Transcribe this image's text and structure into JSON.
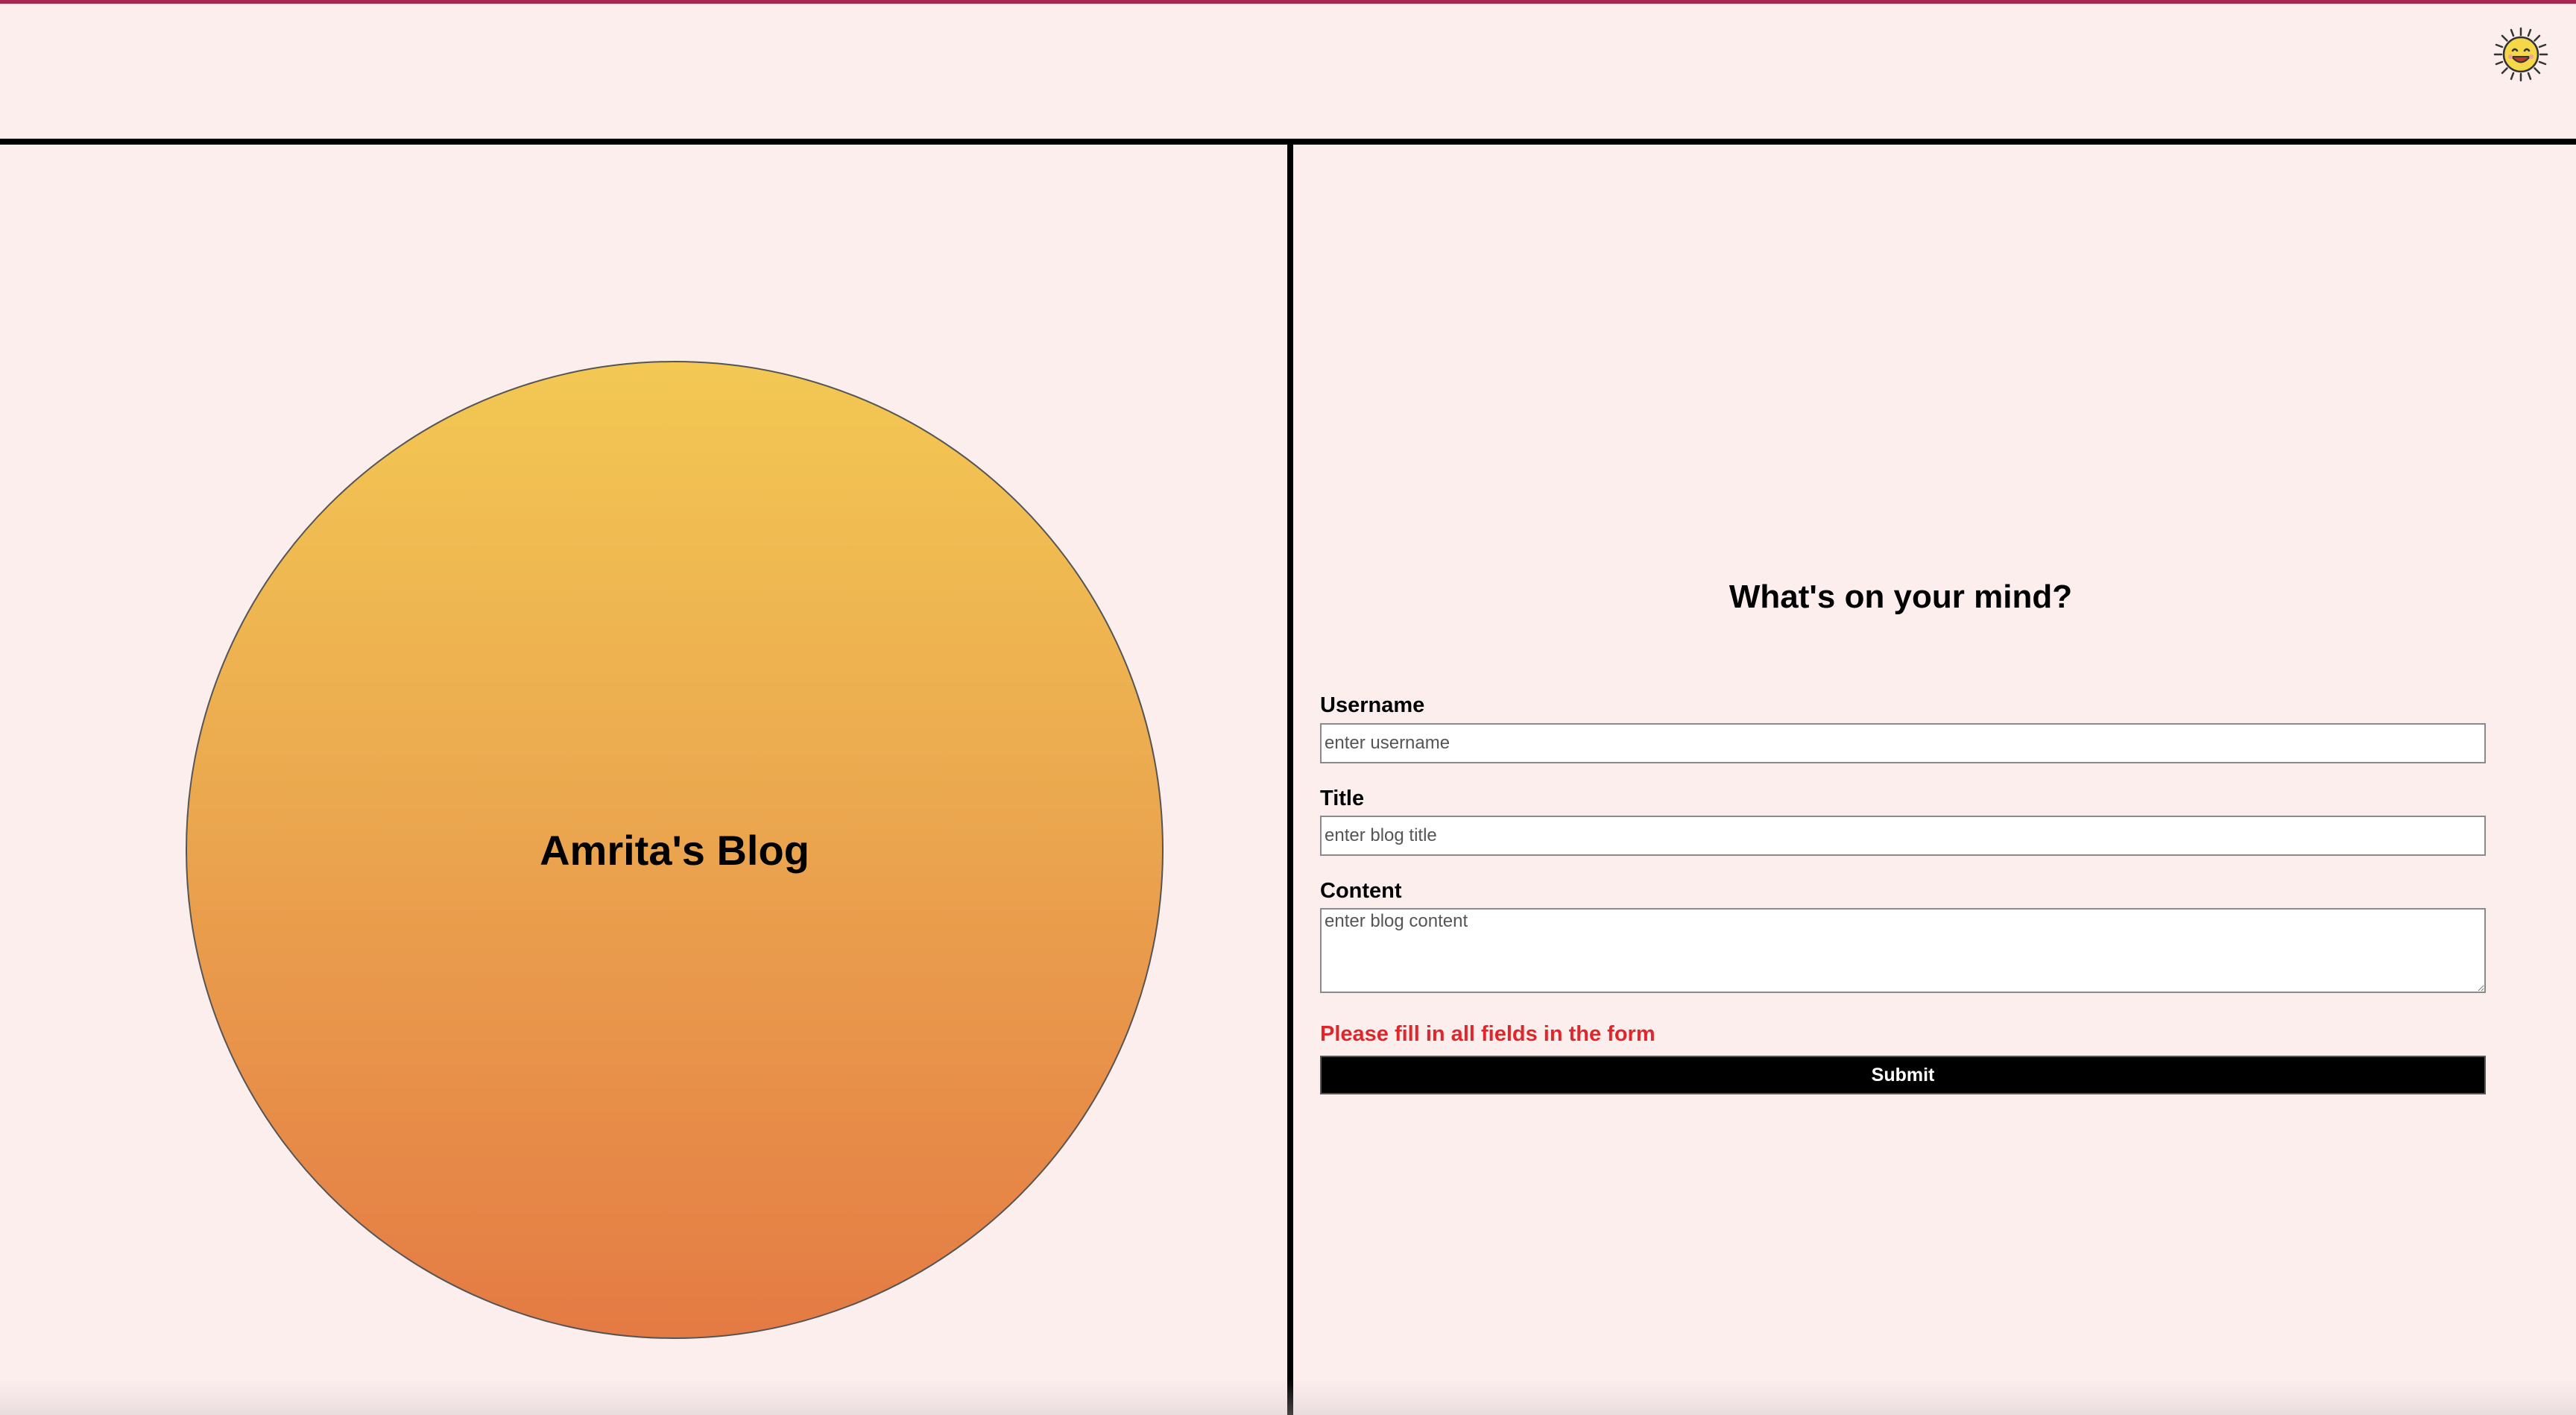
{
  "header": {
    "theme_toggle_icon": "sun-emoji-icon"
  },
  "hero": {
    "title": "Amrita's Blog",
    "gradient_top": "#f3c853",
    "gradient_bottom": "#e47a44"
  },
  "form": {
    "heading": "What's on your mind?",
    "username_label": "Username",
    "username_placeholder": "enter username",
    "title_label": "Title",
    "title_placeholder": "enter blog title",
    "content_label": "Content",
    "content_placeholder": "enter blog content",
    "error_message": "Please fill in all fields in the form",
    "submit_label": "Submit"
  },
  "colors": {
    "background": "#fdeeee",
    "accent_bar": "#a8264f",
    "error": "#e0262a",
    "button": "#000000"
  }
}
